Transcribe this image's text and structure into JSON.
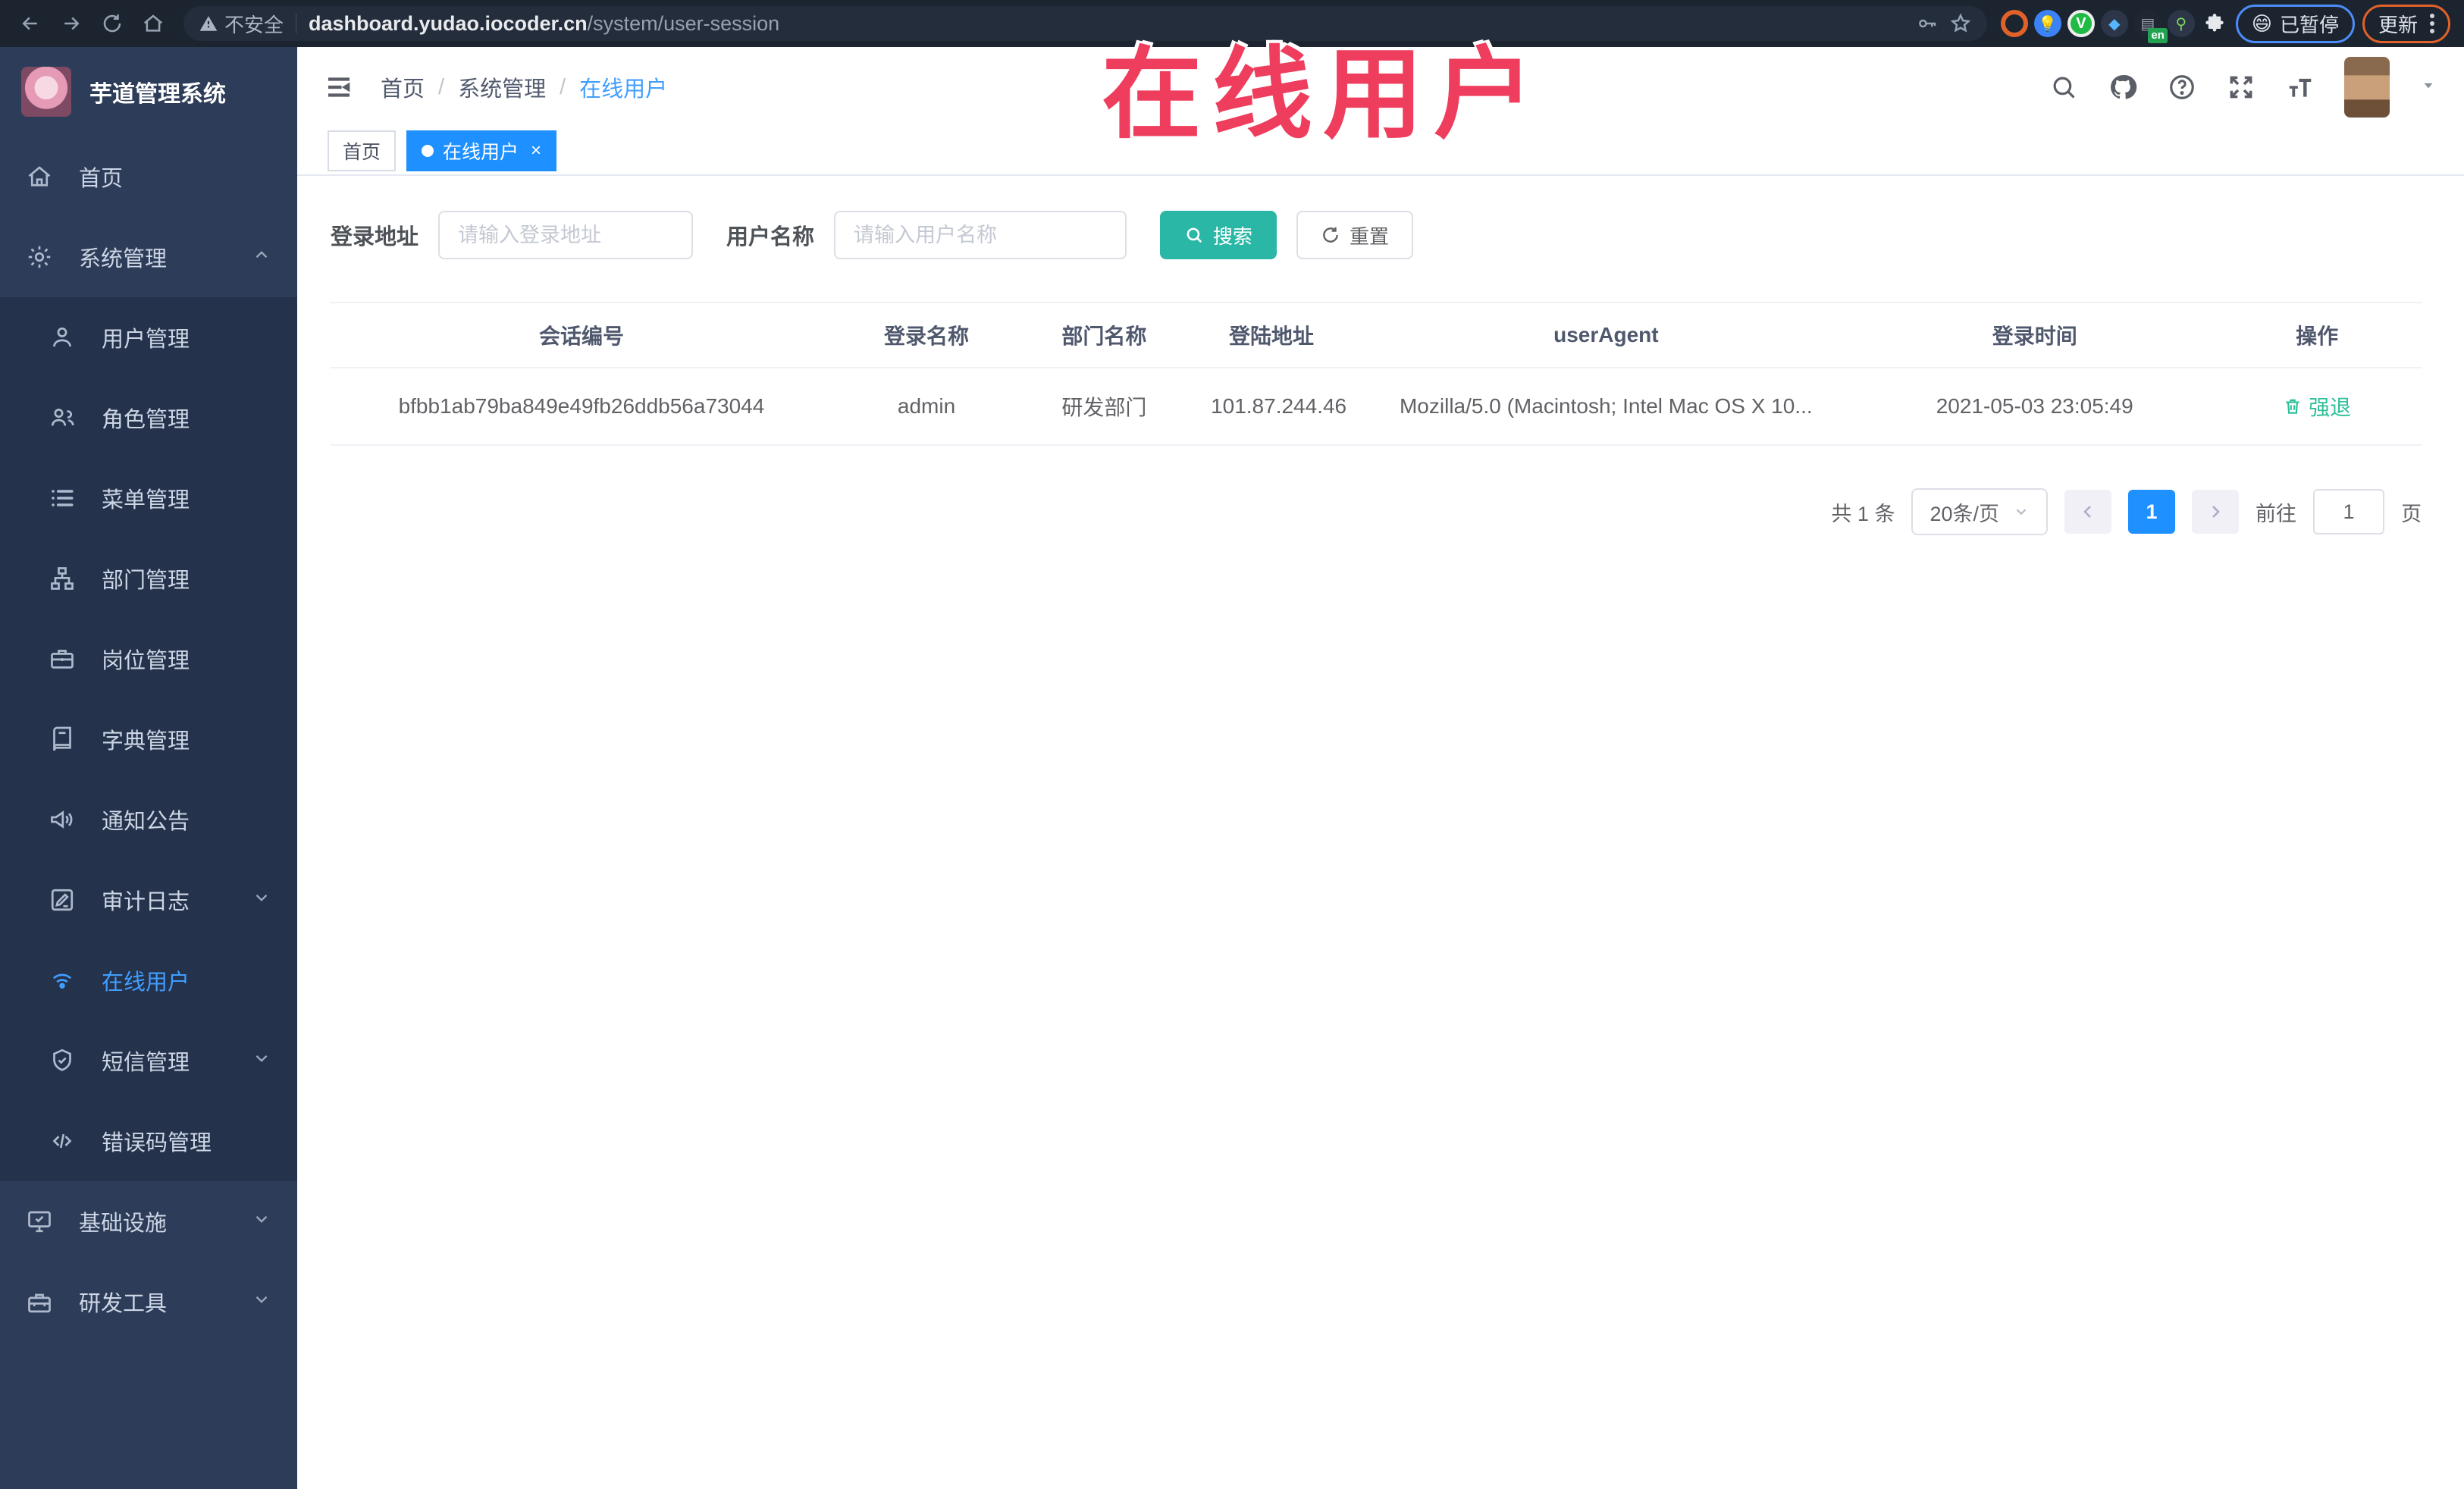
{
  "annotation": {
    "title": "在线用户"
  },
  "browser": {
    "security_label": "不安全",
    "url_host": "dashboard.yudao.iocoder.cn",
    "url_path": "/system/user-session",
    "extension_badge": "en",
    "profile_emoji": "😄",
    "profile_chip_label": "已暂停",
    "update_button_label": "更新"
  },
  "sidebar": {
    "logo_title": "芋道管理系统",
    "menu": [
      {
        "name": "home",
        "label": "首页",
        "icon": "home-icon",
        "level": "root",
        "active": false,
        "chevron": ""
      },
      {
        "name": "system-mgmt",
        "label": "系统管理",
        "icon": "gear-icon",
        "level": "root",
        "active": false,
        "chevron": "up"
      },
      {
        "name": "user-mgmt",
        "label": "用户管理",
        "icon": "user-icon",
        "level": "sub",
        "active": false,
        "chevron": ""
      },
      {
        "name": "role-mgmt",
        "label": "角色管理",
        "icon": "roles-icon",
        "level": "sub",
        "active": false,
        "chevron": ""
      },
      {
        "name": "menu-mgmt",
        "label": "菜单管理",
        "icon": "menu-list-icon",
        "level": "sub",
        "active": false,
        "chevron": ""
      },
      {
        "name": "dept-mgmt",
        "label": "部门管理",
        "icon": "dept-tree-icon",
        "level": "sub",
        "active": false,
        "chevron": ""
      },
      {
        "name": "post-mgmt",
        "label": "岗位管理",
        "icon": "briefcase-icon",
        "level": "sub",
        "active": false,
        "chevron": ""
      },
      {
        "name": "dict-mgmt",
        "label": "字典管理",
        "icon": "book-icon",
        "level": "sub",
        "active": false,
        "chevron": ""
      },
      {
        "name": "notice",
        "label": "通知公告",
        "icon": "megaphone-icon",
        "level": "sub",
        "active": false,
        "chevron": ""
      },
      {
        "name": "audit-log",
        "label": "审计日志",
        "icon": "edit-square-icon",
        "level": "sub",
        "active": false,
        "chevron": "down"
      },
      {
        "name": "online-user",
        "label": "在线用户",
        "icon": "online-icon",
        "level": "sub",
        "active": true,
        "chevron": ""
      },
      {
        "name": "sms-mgmt",
        "label": "短信管理",
        "icon": "shield-check-icon",
        "level": "sub",
        "active": false,
        "chevron": "down"
      },
      {
        "name": "error-code",
        "label": "错误码管理",
        "icon": "code-icon",
        "level": "sub",
        "active": false,
        "chevron": ""
      },
      {
        "name": "infra",
        "label": "基础设施",
        "icon": "monitor-icon",
        "level": "root",
        "active": false,
        "chevron": "down"
      },
      {
        "name": "dev-tools",
        "label": "研发工具",
        "icon": "toolbox-icon",
        "level": "root",
        "active": false,
        "chevron": "down"
      }
    ]
  },
  "header": {
    "breadcrumb": [
      "首页",
      "系统管理",
      "在线用户"
    ]
  },
  "tabs": [
    {
      "label": "首页",
      "active": false
    },
    {
      "label": "在线用户",
      "active": true
    }
  ],
  "filters": {
    "login_address_label": "登录地址",
    "login_address_placeholder": "请输入登录地址",
    "username_label": "用户名称",
    "username_placeholder": "请输入用户名称",
    "search_label": "搜索",
    "reset_label": "重置"
  },
  "table": {
    "columns": [
      "会话编号",
      "登录名称",
      "部门名称",
      "登陆地址",
      "userAgent",
      "登录时间",
      "操作"
    ],
    "rows": [
      {
        "session_id": "bfbb1ab79ba849e49fb26ddb56a73044",
        "login_name": "admin",
        "dept_name": "研发部门",
        "login_address": "101.87.244.46",
        "user_agent": "Mozilla/5.0 (Macintosh; Intel Mac OS X 10...",
        "login_time": "2021-05-03 23:05:49",
        "action_label": "强退"
      }
    ]
  },
  "pagination": {
    "total_label": "共 1 条",
    "page_size_label": "20条/页",
    "current_page": "1",
    "goto_label": "前往",
    "goto_value": "1",
    "page_unit_label": "页"
  },
  "colors": {
    "accent_blue": "#409eff",
    "teal_button": "#2ab7a5",
    "action_green": "#2fbf9b",
    "annotation_red": "#ee3d5d"
  }
}
